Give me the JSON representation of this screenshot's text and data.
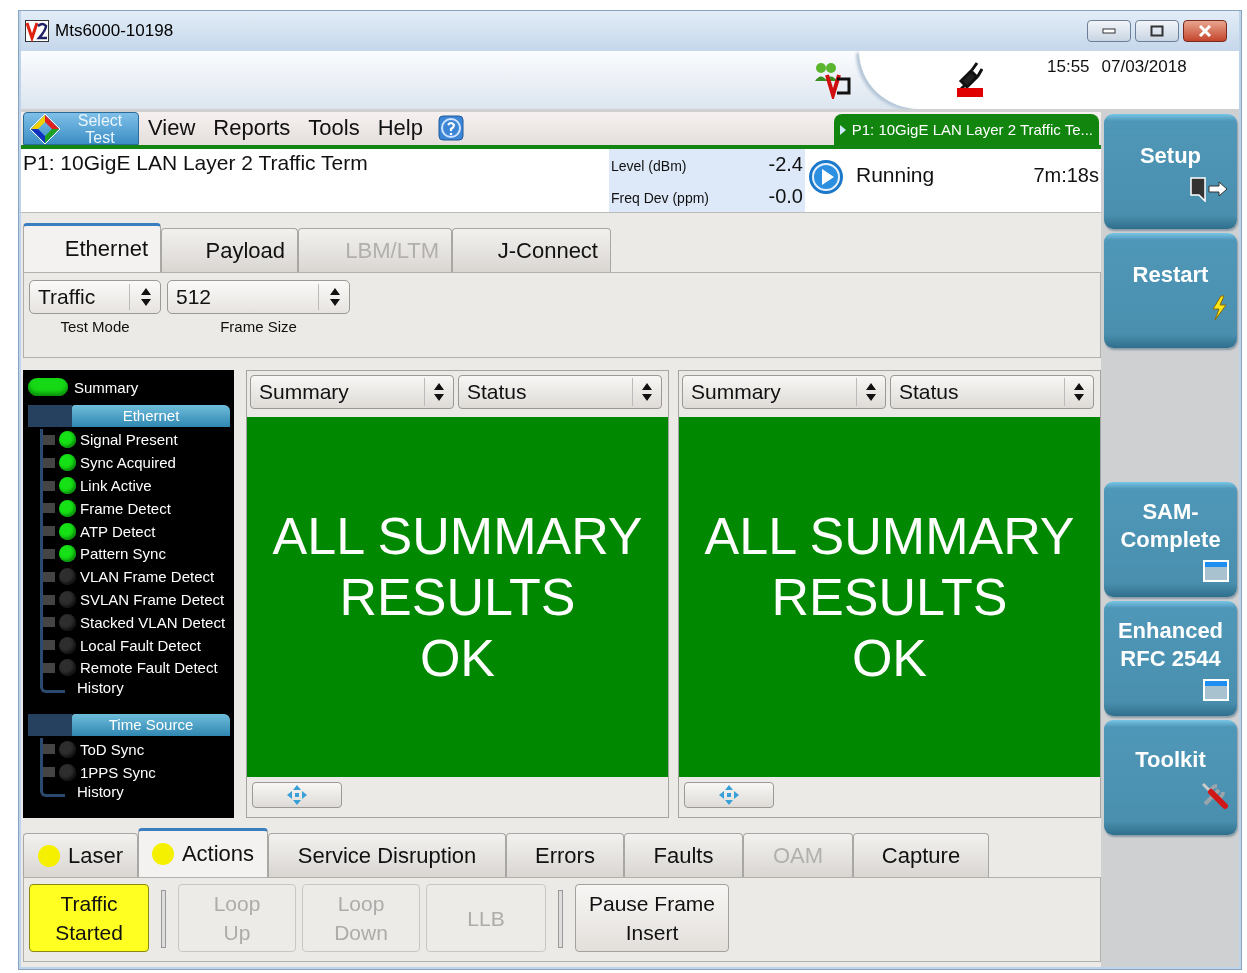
{
  "window": {
    "title": "Mts6000-10198"
  },
  "toolbar": {
    "time": "15:55",
    "date": "07/03/2018"
  },
  "menu": {
    "select_test": "Select Test",
    "items": [
      "View",
      "Reports",
      "Tools",
      "Help"
    ]
  },
  "test_tab": {
    "label": "P1: 10GigE LAN Layer 2 Traffic Te..."
  },
  "test_info": {
    "name": "P1: 10GigE LAN Layer 2 Traffic Term",
    "readings": [
      {
        "label": "Level (dBm)",
        "value": "-2.4"
      },
      {
        "label": "Freq Dev (ppm)",
        "value": "-0.0"
      }
    ],
    "status": "Running",
    "elapsed": "7m:18s"
  },
  "setup_tabs": [
    {
      "label": "Ethernet",
      "selected": true,
      "disabled": false
    },
    {
      "label": "Payload",
      "selected": false,
      "disabled": false
    },
    {
      "label": "LBM/LTM",
      "selected": false,
      "disabled": true
    },
    {
      "label": "J-Connect",
      "selected": false,
      "disabled": false
    }
  ],
  "setup_fields": [
    {
      "value": "Traffic",
      "label": "Test Mode"
    },
    {
      "value": "512",
      "label": "Frame Size"
    }
  ],
  "status_panel": {
    "summary": {
      "label": "Summary",
      "on": true
    },
    "groups": [
      {
        "title": "Ethernet",
        "items": [
          {
            "label": "Signal Present",
            "on": true
          },
          {
            "label": "Sync Acquired",
            "on": true
          },
          {
            "label": "Link Active",
            "on": true
          },
          {
            "label": "Frame Detect",
            "on": true
          },
          {
            "label": "ATP Detect",
            "on": true
          },
          {
            "label": "Pattern Sync",
            "on": true
          },
          {
            "label": "VLAN Frame Detect",
            "on": false
          },
          {
            "label": "SVLAN Frame Detect",
            "on": false
          },
          {
            "label": "Stacked VLAN Detect",
            "on": false
          },
          {
            "label": "Local Fault Detect",
            "on": false
          },
          {
            "label": "Remote Fault Detect",
            "on": false
          }
        ],
        "history": "History"
      },
      {
        "title": "Time Source",
        "items": [
          {
            "label": "ToD Sync",
            "on": false
          },
          {
            "label": "1PPS Sync",
            "on": false
          }
        ],
        "history": "History"
      }
    ]
  },
  "result_panes": [
    {
      "selectors": [
        "Summary",
        "Status"
      ],
      "message_lines": [
        "ALL SUMMARY",
        "RESULTS",
        "OK"
      ]
    },
    {
      "selectors": [
        "Summary",
        "Status"
      ],
      "message_lines": [
        "ALL SUMMARY",
        "RESULTS",
        "OK"
      ]
    }
  ],
  "action_tabs": [
    {
      "label": "Laser",
      "indicator": true,
      "selected": false,
      "disabled": false
    },
    {
      "label": "Actions",
      "indicator": true,
      "selected": true,
      "disabled": false
    },
    {
      "label": "Service Disruption",
      "indicator": false,
      "selected": false,
      "disabled": false
    },
    {
      "label": "Errors",
      "indicator": false,
      "selected": false,
      "disabled": false
    },
    {
      "label": "Faults",
      "indicator": false,
      "selected": false,
      "disabled": false
    },
    {
      "label": "OAM",
      "indicator": false,
      "selected": false,
      "disabled": true
    },
    {
      "label": "Capture",
      "indicator": false,
      "selected": false,
      "disabled": false
    }
  ],
  "action_groups": [
    [
      {
        "label": "Traffic Started",
        "on": true,
        "disabled": false
      }
    ],
    [
      {
        "label": "Loop Up",
        "disabled": true
      },
      {
        "label": "Loop Down",
        "disabled": true
      },
      {
        "label": "LLB",
        "disabled": true
      }
    ],
    [
      {
        "label": "Pause Frame Insert",
        "disabled": false
      }
    ]
  ],
  "side_buttons": [
    {
      "label": "Setup",
      "kind": "setup"
    },
    {
      "label": "Restart",
      "kind": "restart"
    },
    {
      "label": "SAM-Complete",
      "kind": "window"
    },
    {
      "label": "Enhanced RFC 2544",
      "kind": "window"
    },
    {
      "label": "Toolkit",
      "kind": "tools"
    }
  ]
}
